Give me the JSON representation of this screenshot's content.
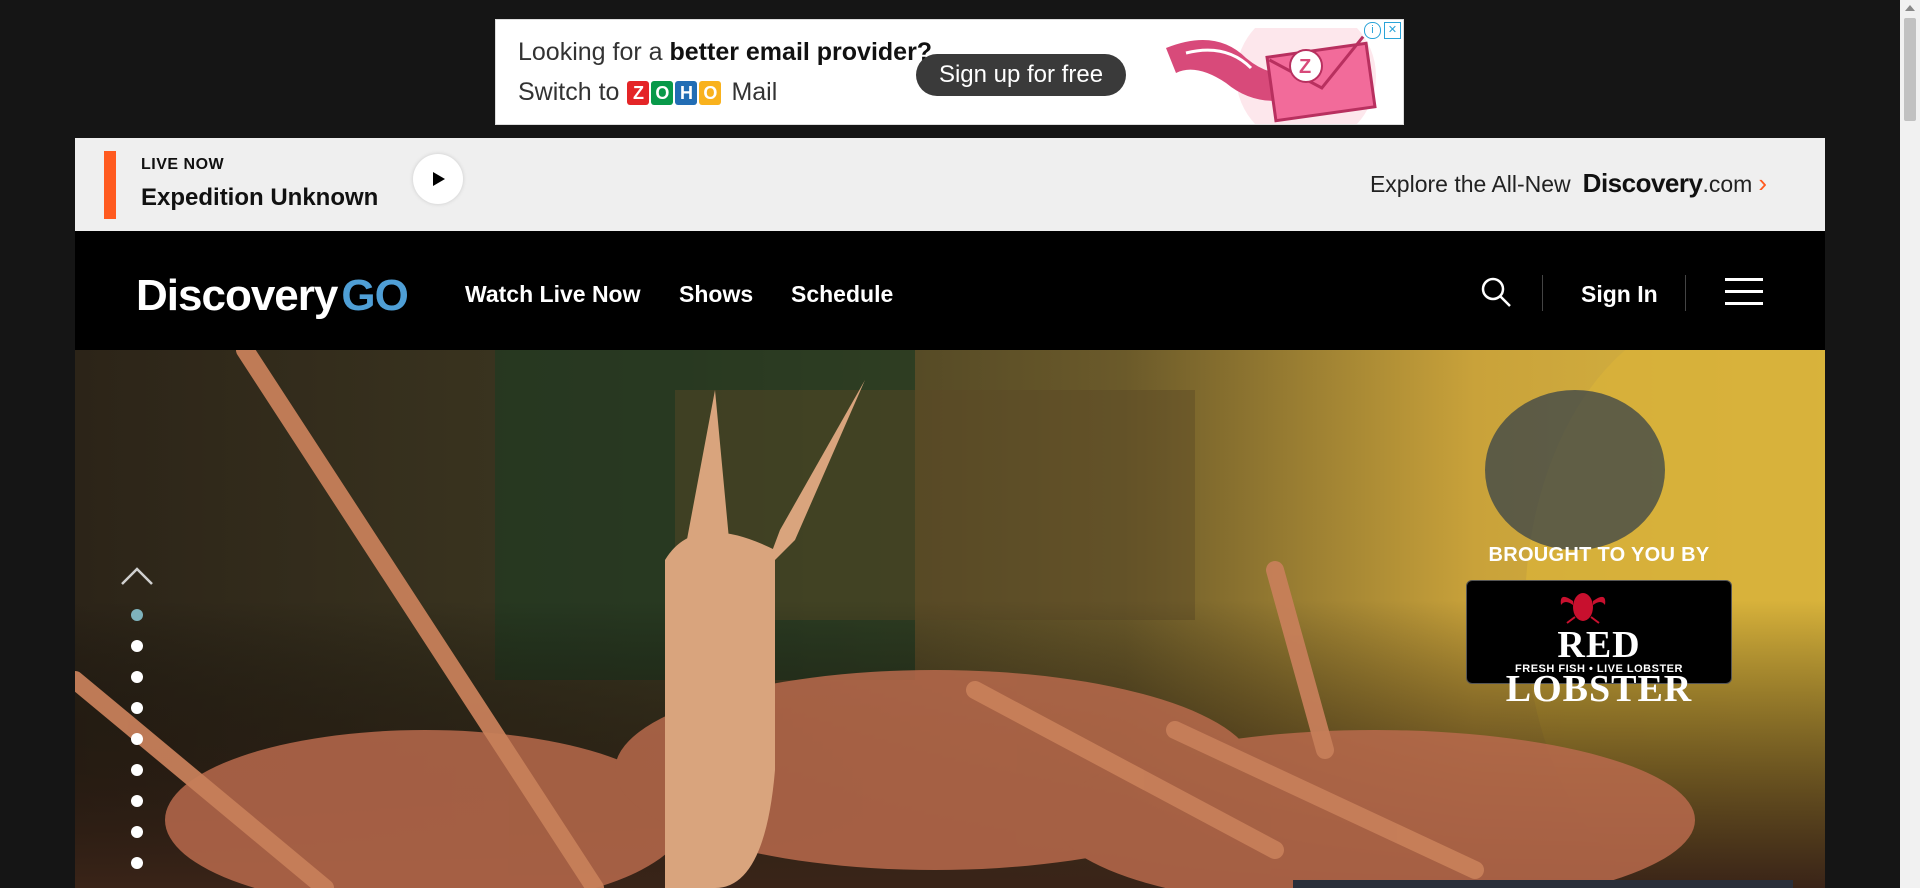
{
  "ad": {
    "line1_prefix": "Looking for a ",
    "line1_bold": "better email provider?",
    "line2_prefix": "Switch to",
    "zoho_letters": [
      "Z",
      "O",
      "H",
      "O"
    ],
    "zoho_colors": [
      "#e42527",
      "#089949",
      "#226db4",
      "#f9b21d"
    ],
    "product": "Mail",
    "cta": "Sign up for free"
  },
  "live": {
    "label": "LIVE NOW",
    "show": "Expedition Unknown",
    "accent_color": "#ff5a1f",
    "explore_prefix": "Explore the All-New",
    "explore_brand": "Discovery",
    "explore_suffix": ".com"
  },
  "nav": {
    "logo_main": "Discovery",
    "logo_go": "GO",
    "links": [
      "Watch Live Now",
      "Shows",
      "Schedule"
    ],
    "sign_in": "Sign In",
    "icons": [
      "search-icon",
      "hamburger-menu-icon"
    ]
  },
  "hero": {
    "slide_count": 9,
    "active_slide": 1,
    "sponsor_label": "BROUGHT TO YOU BY",
    "sponsor_name": "RED LOBSTER",
    "sponsor_tagline": "FRESH FISH • LIVE LOBSTER"
  }
}
